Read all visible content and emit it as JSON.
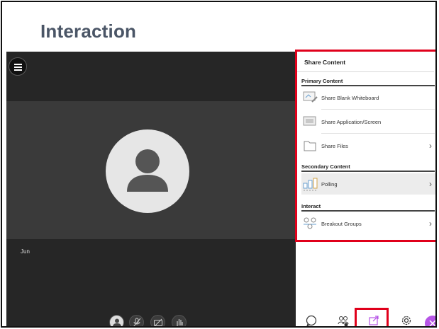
{
  "slide": {
    "title": "Interaction"
  },
  "video": {
    "participant_name": "Jun"
  },
  "panel": {
    "title": "Share Content",
    "sections": {
      "primary": "Primary Content",
      "secondary": "Secondary Content",
      "interact": "Interact"
    },
    "items": {
      "whiteboard": "Share Blank Whiteboard",
      "screen": "Share Application/Screen",
      "files": "Share Files",
      "polling": "Polling",
      "breakout": "Breakout Groups"
    },
    "chevron": "›"
  },
  "colors": {
    "highlight": "#e0001b",
    "accent_purple": "#b655e6",
    "stage_bg": "#262626",
    "video_bg": "#3a3a3a"
  },
  "icons": {
    "menu": "hamburger-icon",
    "avatar": "person-silhouette",
    "mic": "mic-muted-icon",
    "camera": "camera-off-icon",
    "hand": "raise-hand-icon",
    "chat": "chat-icon",
    "attendees": "attendees-icon",
    "share": "share-content-icon",
    "settings": "gear-icon",
    "close": "close-icon"
  }
}
